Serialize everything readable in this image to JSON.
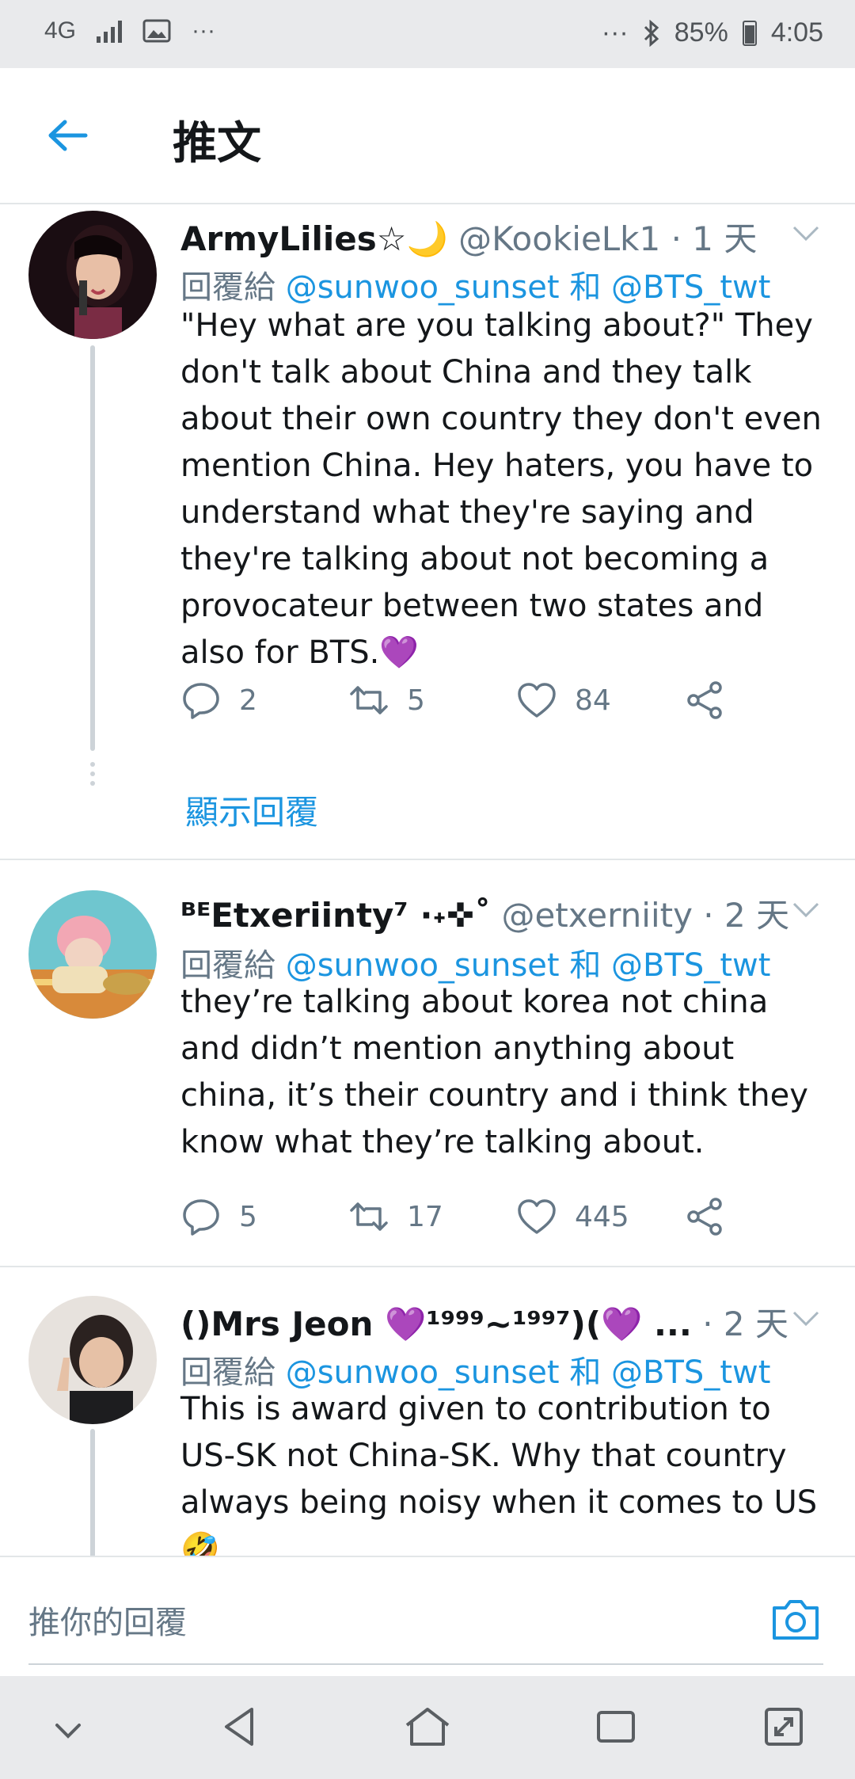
{
  "status_bar": {
    "network": "4G",
    "dots_left": "···",
    "dots_right": "···",
    "battery": "85%",
    "time": "4:05"
  },
  "header": {
    "title": "推文"
  },
  "tweets": [
    {
      "name": "ArmyLilies☆🌙",
      "handle": "@KookieLk1 · 1 天",
      "reply_prefix": "回覆給 ",
      "mention1": "@sunwoo_sunset",
      "conj": " 和 ",
      "mention2": "@BTS_twt",
      "text": "\"Hey what are you talking about?\" They don't talk about China and they talk about their own country they don't even mention China. Hey haters, you have to understand what they're saying and they're talking about not becoming a provocateur between two states and also for BTS.💜",
      "replies": "2",
      "retweets": "5",
      "likes": "84",
      "show_replies": "顯示回覆"
    },
    {
      "name": "ᴮᴱEtxeriinty⁷ ·˖✜˚",
      "handle": "@etxerniity · 2 天",
      "reply_prefix": "回覆給 ",
      "mention1": "@sunwoo_sunset",
      "conj": " 和 ",
      "mention2": "@BTS_twt",
      "text": "they’re talking about korea not china and didn’t mention anything about china, it’s their country and i think they know what they’re talking about.",
      "replies": "5",
      "retweets": "17",
      "likes": "445"
    },
    {
      "name": "()Mrs Jeon 💜¹⁹⁹⁹~¹⁹⁹⁷)(💜 ...",
      "handle": " · 2 天",
      "reply_prefix": "回覆給 ",
      "mention1": "@sunwoo_sunset",
      "conj": " 和 ",
      "mention2": "@BTS_twt",
      "text": "This is award given to contribution to US-SK not China-SK. Why that country always being noisy when it comes to US 🤣"
    }
  ],
  "reply_bar": {
    "placeholder": "推你的回覆"
  },
  "colors": {
    "accent": "#1b95e0",
    "muted": "#657786",
    "divider": "#e3e6e8"
  }
}
